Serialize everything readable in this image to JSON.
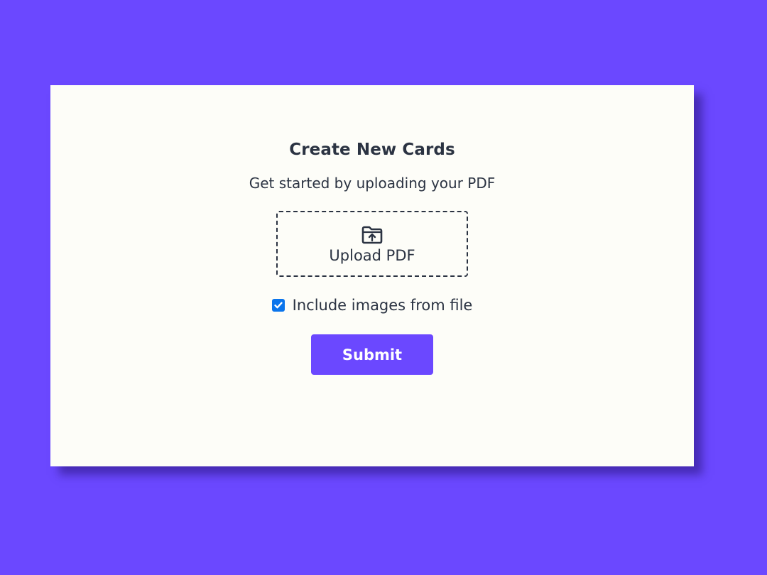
{
  "colors": {
    "background": "#6b48ff",
    "card": "#fdfdf8",
    "text": "#2b3342",
    "accent": "#6b48ff",
    "checkbox": "#0b75ec"
  },
  "card": {
    "title": "Create New Cards",
    "subtitle": "Get started by uploading your PDF",
    "upload": {
      "icon": "folder-upload-icon",
      "label": "Upload PDF"
    },
    "include_images": {
      "checked": true,
      "label": "Include images from file"
    },
    "submit_label": "Submit"
  }
}
